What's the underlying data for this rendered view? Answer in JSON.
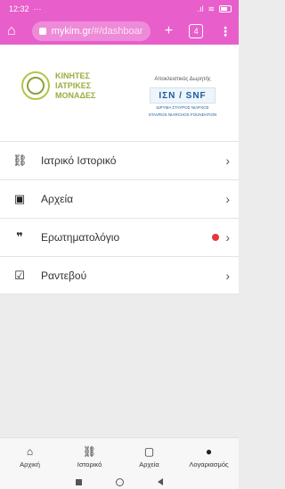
{
  "statusbar": {
    "time": "12:32",
    "dots": "···",
    "signal": ".ıl",
    "wifi": "≋",
    "battery": ""
  },
  "browser": {
    "url_host": "mykim.gr",
    "url_path": "/#/dashboar",
    "tab_count": "4"
  },
  "header": {
    "logo_lines": [
      "ΚΙΝΗΤΕΣ",
      "ΙΑΤΡΙΚΕΣ",
      "ΜΟΝΑΔΕΣ"
    ],
    "sponsor_label": "Αποκλειστικός Δωρητής",
    "sponsor_logo": "ΙΣΝ / SNF",
    "sponsor_sub1": "ΙΔΡΥΜΑ ΣΤΑΥΡΟΣ ΝΙΑΡΧΟΣ",
    "sponsor_sub2": "STAVROS NIARCHOS FOUNDATION"
  },
  "menu": {
    "items": [
      {
        "label": "Ιατρικό Ιστορικό",
        "icon": "hand-heart-icon"
      },
      {
        "label": "Αρχεία",
        "icon": "folder-image-icon"
      },
      {
        "label": "Ερωτηματολόγιο",
        "icon": "quote-icon",
        "notification": true
      },
      {
        "label": "Ραντεβού",
        "icon": "calendar-check-icon"
      }
    ]
  },
  "tabs": [
    {
      "label": "Αρχική",
      "icon": "home-icon"
    },
    {
      "label": "Ιστορικό",
      "icon": "hand-heart-icon"
    },
    {
      "label": "Αρχεία",
      "icon": "document-icon"
    },
    {
      "label": "Λογαριασμός",
      "icon": "person-icon"
    }
  ],
  "colors": {
    "accent": "#e85fcb",
    "notification": "#e53935",
    "brand_green": "#9bae3e",
    "sponsor_blue": "#1d5c99"
  }
}
